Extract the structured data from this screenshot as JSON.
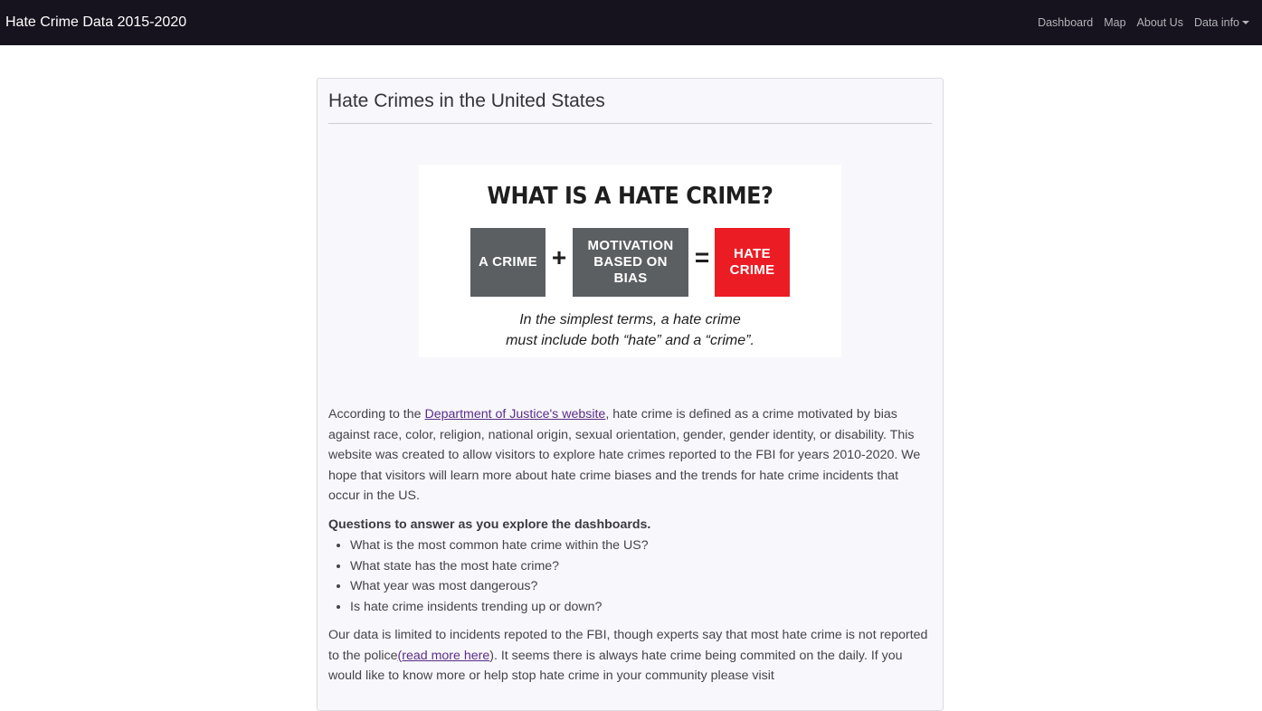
{
  "navbar": {
    "brand": "Hate Crime Data 2015-2020",
    "links": [
      "Dashboard",
      "Map",
      "About Us",
      "Data info"
    ]
  },
  "card": {
    "title": "Hate Crimes in the United States",
    "infographic": {
      "title": "WHAT IS A HATE CRIME?",
      "box1": "A CRIME",
      "plus": "+",
      "box2_lines": [
        "MOTIVATION",
        "BASED ON",
        "BIAS"
      ],
      "equals": "=",
      "box3_lines": [
        "HATE",
        "CRIME"
      ],
      "caption_lines": [
        "In the simplest terms, a hate crime",
        "must include both “hate” and a “crime”."
      ],
      "colors": {
        "gray": "#5c5f62",
        "red": "#ec1c24"
      }
    },
    "intro": {
      "before_link": "According to the ",
      "link": "Department of Justice's website",
      "after_link": ", hate crime is defined as a crime motivated by bias against race, color, religion, national origin, sexual orientation, gender, gender identity, or disability. This website was created to allow visitors to explore hate crimes reported to the FBI for years 2010-2020. We hope that visitors will learn more about hate crime biases and the trends for hate crime incidents that occur in the US."
    },
    "questions_heading": "Questions to answer as you explore the dashboards.",
    "questions": [
      "What is the most common hate crime within the US?",
      "What state has the most hate crime?",
      "What year was most dangerous?",
      "Is hate crime insidents trending up or down?"
    ],
    "closing": {
      "before_link": "Our data is limited to incidents repoted to the FBI, though experts say that most hate crime is not reported to the police",
      "link": "(read more here",
      "after_link": "). It seems there is always hate crime being commited on the daily. If you would like to know more or help stop hate crime in your community please visit"
    }
  }
}
